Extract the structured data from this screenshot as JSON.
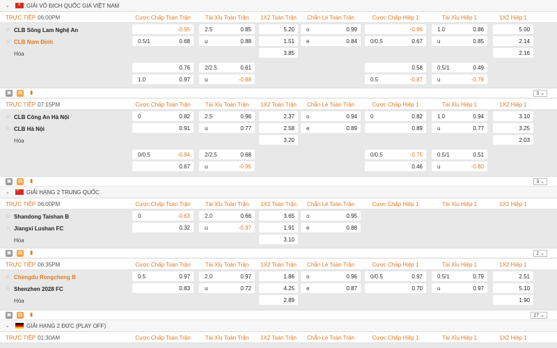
{
  "columns": [
    "Cược Chấp Toàn Trận",
    "Tài Xỉu Toàn Trận",
    "1X2 Toàn Trận",
    "Chẵn Lẻ Toàn Trận",
    "Cược Chấp Hiệp 1",
    "Tài Xỉu Hiệp 1",
    "1X2 Hiệp 1"
  ],
  "live_label": "TRỰC TIẾP",
  "draw_label": "Hòa",
  "leagues": [
    {
      "name": "GIẢI VÔ ĐỊCH QUỐC GIA VIỆT NAM"
    },
    {
      "name": "GIẢI HẠNG 2 TRUNG QUỐC"
    },
    {
      "name": "GIẢI HẠNG 2 ĐỨC (PLAY OFF)"
    }
  ],
  "matches": [
    {
      "time": "06:00PM",
      "home": "CLB Sông Lam Nghệ An",
      "away": "CLB Nam Định",
      "rows": [
        {
          "hdp_l": "",
          "hdp_r": "-0.95",
          "ou_l": "2.5",
          "ou_r": "0.85",
          "x12": "5.20",
          "oe_l": "o",
          "oe_r": "0.99",
          "hdp1_l": "",
          "hdp1_r": "-0.96",
          "ou1_l": "1.0",
          "ou1_r": "0.86",
          "x121": "5.00"
        },
        {
          "hdp_l": "0.5/1",
          "hdp_r": "0.68",
          "ou_l": "u",
          "ou_r": "0.88",
          "x12": "1.51",
          "oe_l": "e",
          "oe_r": "0.84",
          "hdp1_l": "0/0.5",
          "hdp1_r": "0.67",
          "ou1_l": "u",
          "ou1_r": "0.85",
          "x121": "2.14"
        },
        {
          "x12": "3.85",
          "x121": "2.16"
        }
      ],
      "extra": [
        {
          "hdp_l": "",
          "hdp_r": "0.76",
          "ou_l": "2/2.5",
          "ou_r": "0.61",
          "hdp1_l": "",
          "hdp1_r": "0.58",
          "ou1_l": "0.5/1",
          "ou1_r": "0.49"
        },
        {
          "hdp_l": "1.0",
          "hdp_r": "0.97",
          "ou_l": "u",
          "ou_r": "-0.88",
          "hdp1_l": "0.5",
          "hdp1_r": "-0.87",
          "ou1_l": "u",
          "ou1_r": "-0.78"
        }
      ],
      "more": "3"
    },
    {
      "time": "07:15PM",
      "home": "CLB Công An Hà Nội",
      "away": "CLB Hà Nội",
      "rows": [
        {
          "hdp_l": "0",
          "hdp_r": "0.82",
          "ou_l": "2.5",
          "ou_r": "0.96",
          "x12": "2.37",
          "oe_l": "o",
          "oe_r": "0.94",
          "hdp1_l": "0",
          "hdp1_r": "0.82",
          "ou1_l": "1.0",
          "ou1_r": "0.94",
          "x121": "3.10"
        },
        {
          "hdp_l": "",
          "hdp_r": "0.91",
          "ou_l": "u",
          "ou_r": "0.77",
          "x12": "2.58",
          "oe_l": "e",
          "oe_r": "0.89",
          "hdp1_l": "",
          "hdp1_r": "0.89",
          "ou1_l": "u",
          "ou1_r": "0.77",
          "x121": "3.25"
        },
        {
          "x12": "3.20",
          "x121": "2.03"
        }
      ],
      "extra": [
        {
          "hdp_l": "0/0.5",
          "hdp_r": "-0.94",
          "ou_l": "2/2.5",
          "ou_r": "0.68",
          "hdp1_l": "0/0.5",
          "hdp1_r": "-0.75",
          "ou1_l": "0.5/1",
          "ou1_r": "0.51"
        },
        {
          "hdp_l": "",
          "hdp_r": "0.67",
          "ou_l": "u",
          "ou_r": "-0.95",
          "hdp1_l": "",
          "hdp1_r": "0.46",
          "ou1_l": "u",
          "ou1_r": "-0.80"
        }
      ],
      "more": "3"
    },
    {
      "time": "06:00PM",
      "home": "Shandong Taishan B",
      "away": "Jiangxi Lushan FC",
      "rows": [
        {
          "hdp_l": "0",
          "hdp_r": "-0.63",
          "ou_l": "2.0",
          "ou_r": "0.66",
          "x12": "3.65",
          "oe_l": "o",
          "oe_r": "0.95"
        },
        {
          "hdp_l": "",
          "hdp_r": "0.32",
          "ou_l": "u",
          "ou_r": "-0.97",
          "x12": "1.91",
          "oe_l": "e",
          "oe_r": "0.88"
        },
        {
          "x12": "3.10"
        }
      ],
      "more": "2"
    },
    {
      "time": "06:35PM",
      "home": "Chengdu Rongcheng B",
      "away": "Shenzhen 2028 FC",
      "rows": [
        {
          "hdp_l": "0.5",
          "hdp_r": "0.97",
          "ou_l": "2.0",
          "ou_r": "0.97",
          "x12": "1.86",
          "oe_l": "o",
          "oe_r": "0.96",
          "hdp1_l": "0/0.5",
          "hdp1_r": "0.97",
          "ou1_l": "0.5/1",
          "ou1_r": "0.79",
          "x121": "2.51"
        },
        {
          "hdp_l": "",
          "hdp_r": "0.83",
          "ou_l": "u",
          "ou_r": "0.72",
          "x12": "4.25",
          "oe_l": "e",
          "oe_r": "0.87",
          "hdp1_l": "",
          "hdp1_r": "0.70",
          "ou1_l": "u",
          "ou1_r": "0.97",
          "x121": "5.10"
        },
        {
          "x12": "2.89",
          "x121": "1.90"
        }
      ],
      "more": "27"
    },
    {
      "time": "01:30AM"
    }
  ]
}
